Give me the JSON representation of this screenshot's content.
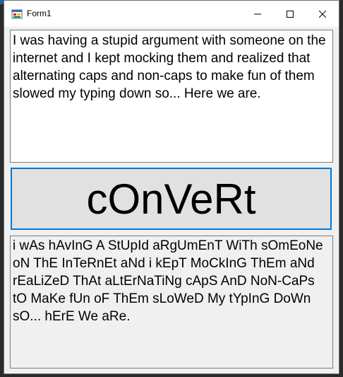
{
  "window": {
    "title": "Form1"
  },
  "input": {
    "text": "I was having a stupid argument with someone on the internet and I kept mocking them and realized that alternating caps and non-caps to make fun of them slowed my typing down so... Here we are."
  },
  "button": {
    "label": "cOnVeRt"
  },
  "output": {
    "text": "i wAs hAvInG A StUpId aRgUmEnT WiTh sOmEoNe oN ThE InTeRnEt aNd i kEpT MoCkInG ThEm aNd rEaLiZeD ThAt aLtErNaTiNg cApS AnD NoN-CaPs tO MaKe fUn oF ThEm sLoWeD My tYpInG DoWn sO... hErE We aRe."
  },
  "colors": {
    "focus_border": "#0078d7",
    "button_face": "#e1e1e1",
    "form_background": "#f0f0f0"
  },
  "icons": {
    "app": "form-app-icon",
    "minimize": "minimize-icon",
    "maximize": "maximize-icon",
    "close": "close-icon"
  }
}
